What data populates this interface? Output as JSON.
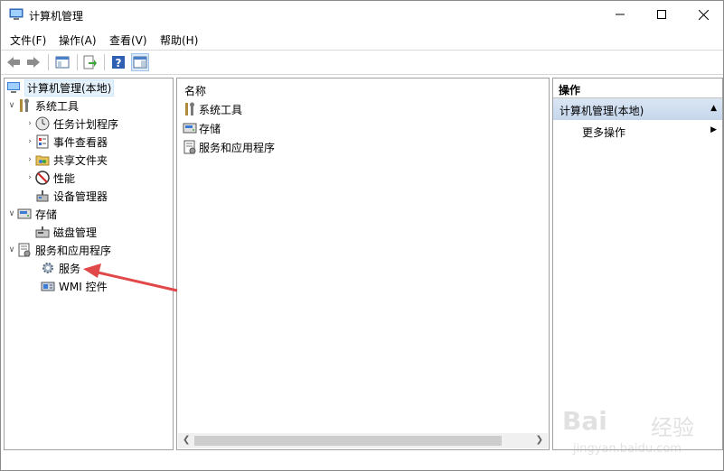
{
  "window": {
    "title": "计算机管理"
  },
  "menu": [
    "文件(F)",
    "操作(A)",
    "查看(V)",
    "帮助(H)"
  ],
  "tree": {
    "root": "计算机管理(本地)",
    "system_tools": "系统工具",
    "task_scheduler": "任务计划程序",
    "event_viewer": "事件查看器",
    "shared_folders": "共享文件夹",
    "performance": "性能",
    "device_manager": "设备管理器",
    "storage": "存储",
    "disk_management": "磁盘管理",
    "services_apps": "服务和应用程序",
    "services": "服务",
    "wmi": "WMI 控件"
  },
  "list": {
    "column_name": "名称",
    "items": [
      "系统工具",
      "存储",
      "服务和应用程序"
    ]
  },
  "actions": {
    "header": "操作",
    "section": "计算机管理(本地)",
    "more": "更多操作"
  },
  "watermark": {
    "brand": "Bai",
    "cn": "经验",
    "url": "jingyan.baidu.com"
  },
  "colors": {
    "annotation_arrow": "#e0484a",
    "selection": "#e5f1fb",
    "actions_section": "#c9d9ee"
  }
}
